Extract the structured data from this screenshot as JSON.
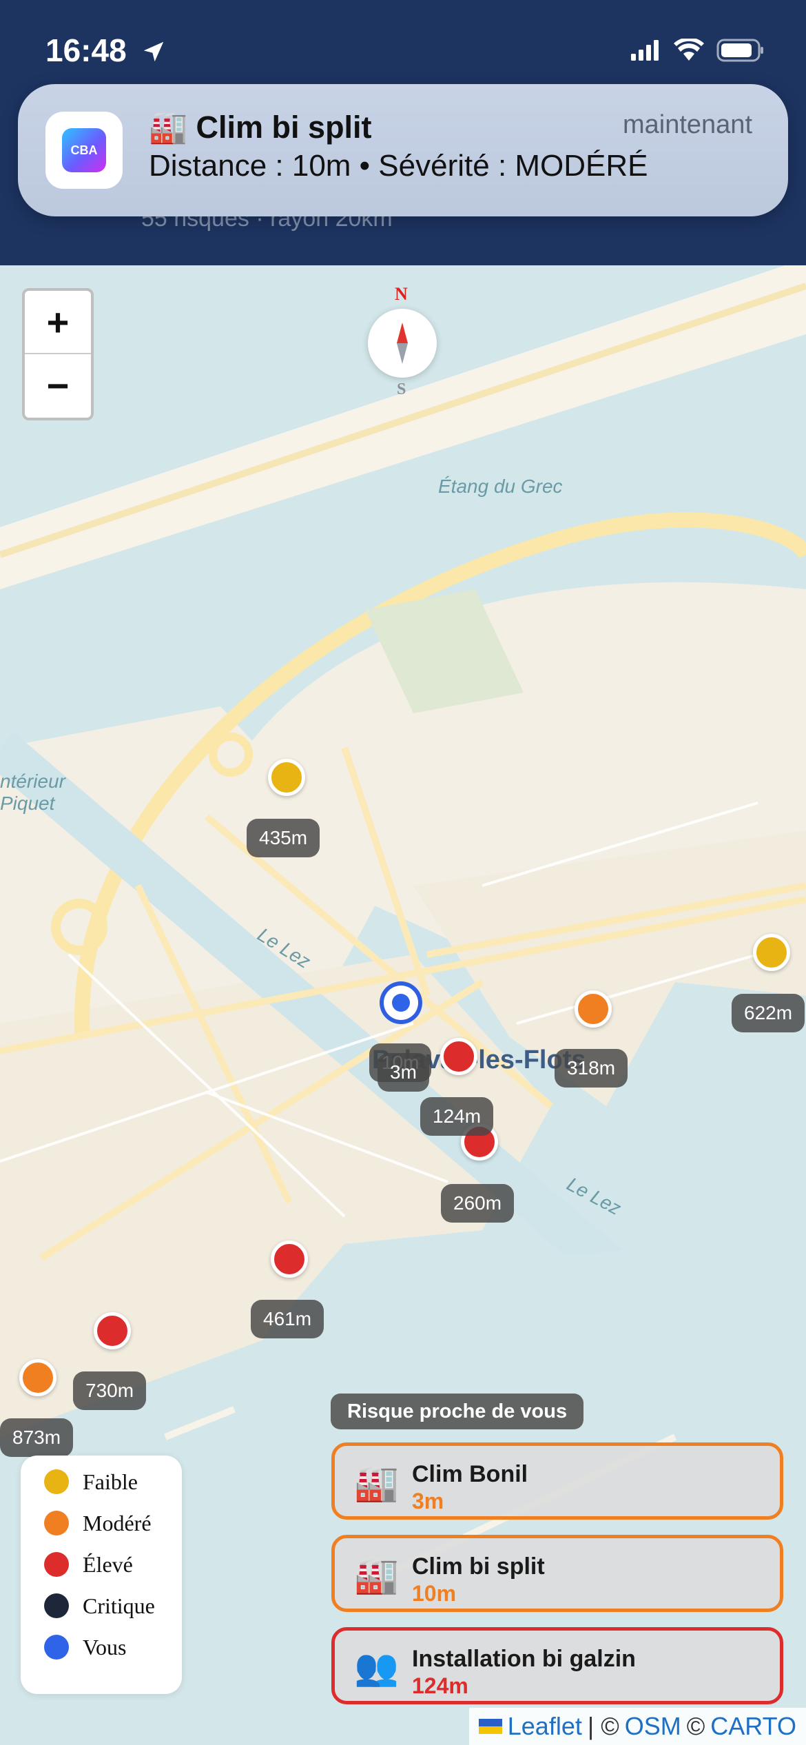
{
  "status_bar": {
    "time": "16:48"
  },
  "notification": {
    "title": "🏭 Clim bi split",
    "body": "Distance : 10m  •  Sévérité : MODÉRÉ",
    "time": "maintenant",
    "app_icon_text": "CBA",
    "icon": "factory-icon"
  },
  "header": {
    "subtitle": "55 risques · rayon 20km"
  },
  "map": {
    "zoom_in": "+",
    "zoom_out": "−",
    "compass": {
      "north": "N",
      "south": "S"
    },
    "labels": {
      "etang": "Étang du Grec",
      "interieur": "ntérieur",
      "piquet": "Piquet",
      "le_lez_1": "Le Lez",
      "le_lez_2": "Le Lez",
      "town": "Palavas-les-Flots"
    },
    "distance_labels": [
      "435m",
      "622m",
      "318m",
      "10m",
      "3m",
      "124m",
      "260m",
      "461m",
      "730m",
      "873m"
    ]
  },
  "legend": [
    {
      "label": "Faible",
      "color": "#e8b414"
    },
    {
      "label": "Modéré",
      "color": "#f07f22"
    },
    {
      "label": "Élevé",
      "color": "#dc2c2c"
    },
    {
      "label": "Critique",
      "color": "#1e2739"
    },
    {
      "label": "Vous",
      "color": "#2f64e8"
    }
  ],
  "nearby": {
    "title": "Risque proche de vous",
    "items": [
      {
        "name": "Clim Bonil",
        "distance": "3m",
        "icon": "🏭",
        "color": "#f07f22"
      },
      {
        "name": "Clim bi split",
        "distance": "10m",
        "icon": "🏭",
        "color": "#f07f22"
      },
      {
        "name": "Installation bi galzin",
        "distance": "124m",
        "icon": "👥",
        "color": "#dc2c2c"
      }
    ]
  },
  "attribution": {
    "leaflet": "Leaflet",
    "sep1": "| ©",
    "osm": "OSM",
    "sep2": "©",
    "carto": "CARTO"
  }
}
